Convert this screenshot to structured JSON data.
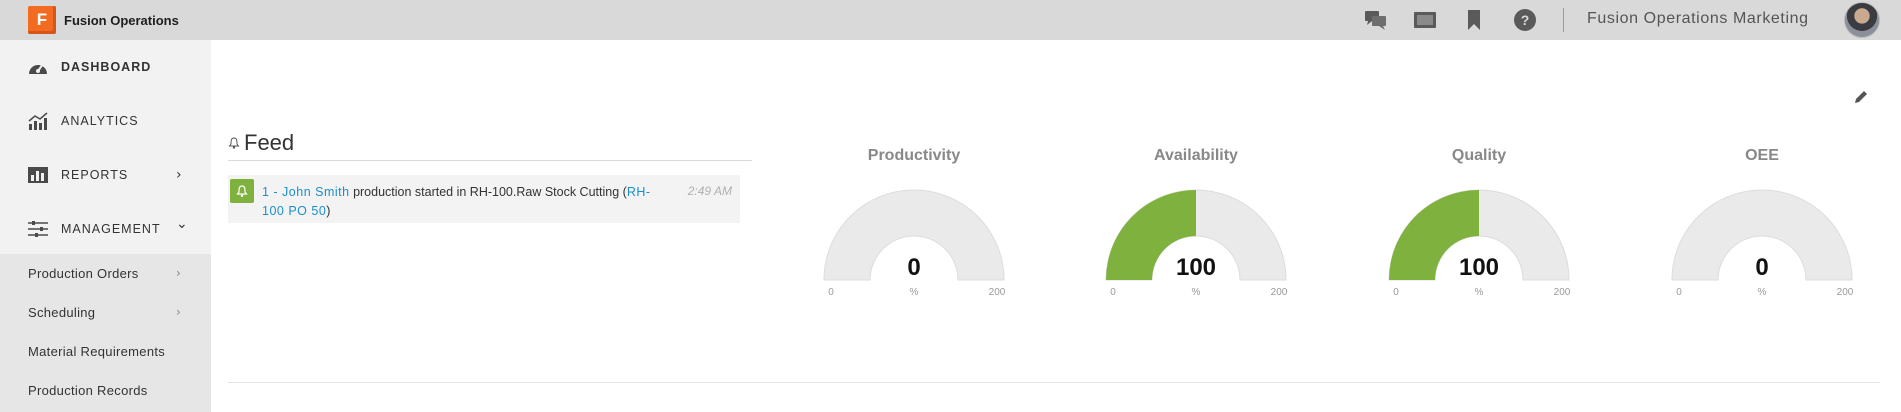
{
  "app": {
    "logo_letter": "F",
    "name": "Fusion Operations",
    "tenant": "Fusion Operations Marketing"
  },
  "topbar": {
    "icons": [
      "chat-icon",
      "tablet-icon",
      "bookmark-icon",
      "help-icon"
    ]
  },
  "sidebar": {
    "items": [
      {
        "label": "DASHBOARD",
        "icon": "gauge-icon"
      },
      {
        "label": "ANALYTICS",
        "icon": "analytics-chart-icon"
      },
      {
        "label": "REPORTS",
        "icon": "reports-bars-icon",
        "chevron": "›"
      },
      {
        "label": "MANAGEMENT",
        "icon": "sliders-icon",
        "chevron": "⌄"
      }
    ],
    "sub_items": [
      {
        "label": "Production Orders",
        "chevron": "›"
      },
      {
        "label": "Scheduling",
        "chevron": "›"
      },
      {
        "label": "Material Requirements"
      },
      {
        "label": "Production Records"
      }
    ]
  },
  "feed": {
    "title": "Feed",
    "items": [
      {
        "link_user": "1 - John Smith",
        "text": " production started in RH-100.Raw Stock Cutting (",
        "link_order": "RH-100 PO 50",
        "text_end": ")",
        "time": "2:49 AM"
      }
    ]
  },
  "kpis": [
    {
      "title": "Productivity",
      "value": "0",
      "unit": "%",
      "min": "0",
      "max": "200",
      "fill_fraction": 0.0
    },
    {
      "title": "Availability",
      "value": "100",
      "unit": "%",
      "min": "0",
      "max": "200",
      "fill_fraction": 0.5
    },
    {
      "title": "Quality",
      "value": "100",
      "unit": "%",
      "min": "0",
      "max": "200",
      "fill_fraction": 0.5
    },
    {
      "title": "OEE",
      "value": "0",
      "unit": "%",
      "min": "0",
      "max": "200",
      "fill_fraction": 0.0
    }
  ],
  "colors": {
    "accent_green": "#7fb13f",
    "gauge_track": "#eaeaea",
    "link_blue": "#1a8fcc",
    "brand_orange": "#f26b21"
  }
}
